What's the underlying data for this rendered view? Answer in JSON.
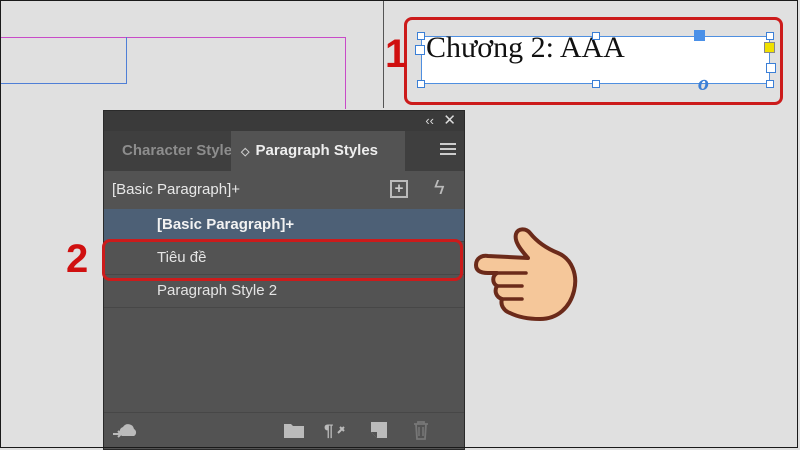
{
  "canvas": {
    "text_frame": {
      "text": "Chương 2: AAA",
      "overset_symbol": "o"
    }
  },
  "callouts": {
    "step1": "1",
    "step2": "2"
  },
  "panel": {
    "tabs": [
      {
        "label": "Character Styles",
        "active": false
      },
      {
        "label": "Paragraph Styles",
        "active": true
      }
    ],
    "tab_chevron": "◇",
    "collapse_glyph": "‹‹",
    "close_glyph": "✕",
    "current_style": "[Basic Paragraph]+",
    "styles": [
      {
        "label": "[Basic Paragraph]+",
        "selected": true
      },
      {
        "label": "Tiêu đề",
        "selected": false
      },
      {
        "label": "Paragraph Style 2",
        "selected": false
      }
    ],
    "icons": {
      "new_group": "+",
      "quick_apply": "ϟ"
    }
  },
  "colors": {
    "accent_red": "#cc1b1b",
    "panel_bg": "#535353",
    "selected_row": "#4d6076",
    "frame_blue": "#4f8fe0"
  }
}
